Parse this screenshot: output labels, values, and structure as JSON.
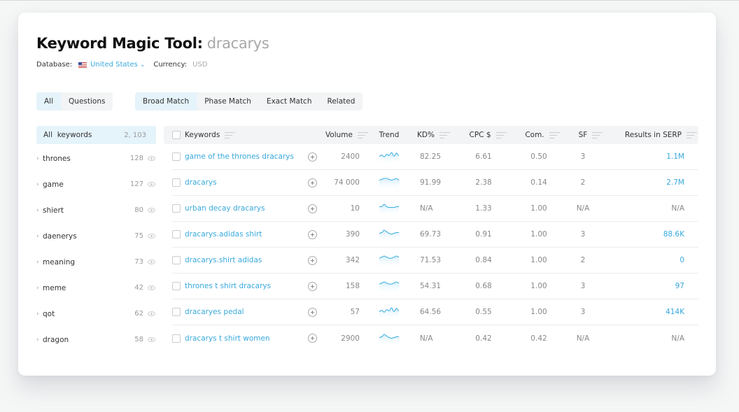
{
  "header": {
    "title": "Keyword Magic Tool:",
    "query": "dracarys",
    "database_label": "Database:",
    "database_value": "United States",
    "currency_label": "Currency:",
    "currency_value": "USD"
  },
  "question_filter": {
    "options": [
      {
        "label": "All",
        "active": true
      },
      {
        "label": "Questions",
        "active": false
      }
    ]
  },
  "match_filter": {
    "options": [
      {
        "label": "Broad Match",
        "active": true
      },
      {
        "label": "Phase Match",
        "active": false
      },
      {
        "label": "Exact Match",
        "active": false
      },
      {
        "label": "Related",
        "active": false
      }
    ]
  },
  "sidebar": {
    "header_label": "All  keywords",
    "header_count": "2, 103",
    "groups": [
      {
        "name": "thrones",
        "count": "128"
      },
      {
        "name": "game",
        "count": "127"
      },
      {
        "name": "shiert",
        "count": "80"
      },
      {
        "name": "daenerys",
        "count": "75"
      },
      {
        "name": "meaning",
        "count": "73"
      },
      {
        "name": "meme",
        "count": "42"
      },
      {
        "name": "qot",
        "count": "62"
      },
      {
        "name": "dragon",
        "count": "58"
      }
    ]
  },
  "table": {
    "columns": {
      "keywords": "Keywords",
      "volume": "Volume",
      "trend": "Trend",
      "kd": "KD%",
      "cpc": "CPC $",
      "com": "Com.",
      "sf": "SF",
      "serp": "Results in SERP"
    },
    "rows": [
      {
        "keyword": "game of the thrones dracarys",
        "volume": "2400",
        "trend": [
          3,
          5,
          2,
          6,
          4,
          9,
          3,
          8,
          4
        ],
        "kd": "82.25",
        "cpc": "6.61",
        "com": "0.50",
        "sf": "3",
        "serp": "1.1M",
        "serp_link": true
      },
      {
        "keyword": "dracarys",
        "volume": "74 000",
        "trend": [
          4,
          5,
          6,
          6,
          5,
          4,
          5,
          6,
          4
        ],
        "kd": "91.99",
        "cpc": "2.38",
        "com": "0.14",
        "sf": "2",
        "serp": "2.7M",
        "serp_link": true
      },
      {
        "keyword": "urban decay dracarys",
        "volume": "10",
        "trend": [
          4,
          4,
          7,
          4,
          3,
          3,
          3,
          4,
          4
        ],
        "kd": "N/A",
        "cpc": "1.33",
        "com": "1.00",
        "sf": "N/A",
        "serp": "N/A",
        "serp_link": false
      },
      {
        "keyword": "dracarys.adidas shirt",
        "volume": "390",
        "trend": [
          3,
          4,
          7,
          5,
          3,
          2,
          3,
          4,
          4
        ],
        "kd": "69.73",
        "cpc": "0.91",
        "com": "1.00",
        "sf": "3",
        "serp": "88.6K",
        "serp_link": true
      },
      {
        "keyword": "dracarys.shirt adidas",
        "volume": "342",
        "trend": [
          3,
          4,
          5,
          4,
          3,
          3,
          4,
          5,
          4
        ],
        "kd": "71.53",
        "cpc": "0.84",
        "com": "1.00",
        "sf": "2",
        "serp": "0",
        "serp_link": true
      },
      {
        "keyword": "thrones t shirt dracarys",
        "volume": "158",
        "trend": [
          3,
          4,
          5,
          4,
          3,
          3,
          4,
          5,
          4
        ],
        "kd": "54.31",
        "cpc": "0.68",
        "com": "1.00",
        "sf": "3",
        "serp": "97",
        "serp_link": true
      },
      {
        "keyword": "dracaryes pedal",
        "volume": "57",
        "trend": [
          3,
          5,
          2,
          6,
          4,
          9,
          3,
          8,
          4
        ],
        "kd": "64.56",
        "cpc": "0.55",
        "com": "1.00",
        "sf": "3",
        "serp": "414K",
        "serp_link": true
      },
      {
        "keyword": "dracarys t shirt women",
        "volume": "2900",
        "trend": [
          3,
          4,
          7,
          5,
          3,
          2,
          3,
          4,
          4
        ],
        "kd": "N/A",
        "cpc": "0.42",
        "com": "0.42",
        "sf": "N/A",
        "serp": "N/A",
        "serp_link": false
      }
    ]
  },
  "colors": {
    "accent": "#38a9dc",
    "active_bg": "#e5f3fb",
    "header_bg": "#f3f4f5"
  }
}
